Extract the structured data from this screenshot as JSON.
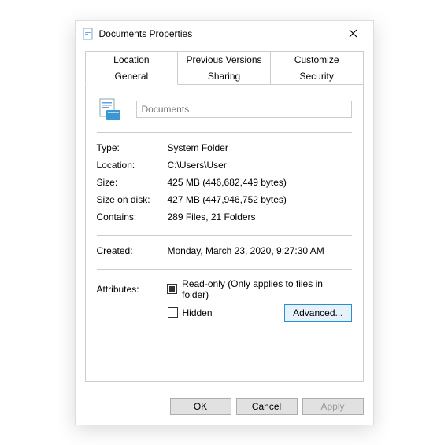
{
  "titlebar": {
    "title": "Documents Properties"
  },
  "tabs": {
    "row1": [
      "Location",
      "Previous Versions",
      "Customize"
    ],
    "row2": [
      "General",
      "Sharing",
      "Security"
    ],
    "active": "General"
  },
  "general": {
    "name": "Documents",
    "rows": {
      "type": {
        "label": "Type:",
        "value": "System Folder"
      },
      "location": {
        "label": "Location:",
        "value": "C:\\Users\\User"
      },
      "size": {
        "label": "Size:",
        "value": "425 MB (446,682,449 bytes)"
      },
      "sizeondisk": {
        "label": "Size on disk:",
        "value": "427 MB (447,946,752 bytes)"
      },
      "contains": {
        "label": "Contains:",
        "value": "289 Files, 21 Folders"
      },
      "created": {
        "label": "Created:",
        "value": "Monday, March 23, 2020, 9:27:30 AM"
      }
    },
    "attributes": {
      "label": "Attributes:",
      "readonly_label": "Read-only (Only applies to files in folder)",
      "hidden_label": "Hidden",
      "advanced_label": "Advanced..."
    }
  },
  "footer": {
    "ok": "OK",
    "cancel": "Cancel",
    "apply": "Apply"
  }
}
